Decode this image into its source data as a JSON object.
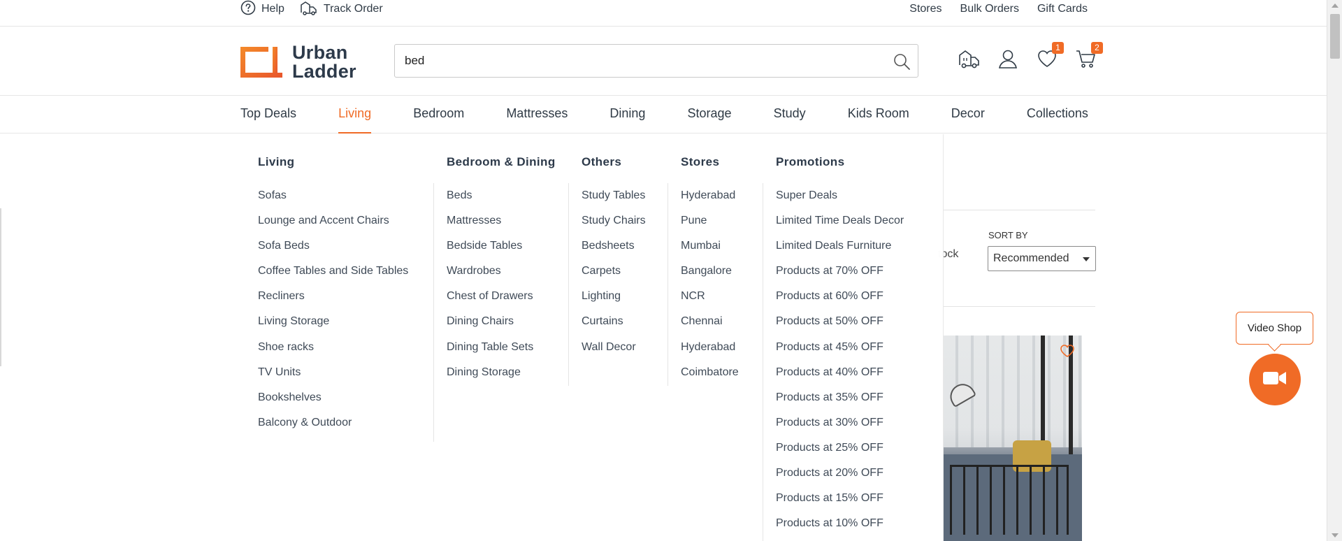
{
  "topbar": {
    "help_label": "Help",
    "track_order_label": "Track Order",
    "links": [
      "Stores",
      "Bulk Orders",
      "Gift Cards"
    ]
  },
  "header": {
    "logo_line1": "Urban",
    "logo_line2": "Ladder",
    "search_value": "bed",
    "wishlist_count": "1",
    "cart_count": "2"
  },
  "nav": {
    "categories": [
      "Top Deals",
      "Living",
      "Bedroom",
      "Mattresses",
      "Dining",
      "Storage",
      "Study",
      "Kids Room",
      "Decor",
      "Collections"
    ],
    "active": "Living"
  },
  "megamenu": {
    "columns": [
      {
        "title": "Living",
        "items": [
          "Sofas",
          "Lounge and Accent Chairs",
          "Sofa Beds",
          "Coffee Tables and Side Tables",
          "Recliners",
          "Living Storage",
          "Shoe racks",
          "TV Units",
          "Bookshelves",
          "Balcony & Outdoor"
        ]
      },
      {
        "title": "Bedroom & Dining",
        "items": [
          "Beds",
          "Mattresses",
          "Bedside Tables",
          "Wardrobes",
          "Chest of Drawers",
          "Dining Chairs",
          "Dining Table Sets",
          "Dining Storage"
        ]
      },
      {
        "title": "Others",
        "items": [
          "Study Tables",
          "Study Chairs",
          "Bedsheets",
          "Carpets",
          "Lighting",
          "Curtains",
          "Wall Decor"
        ]
      },
      {
        "title": "Stores",
        "items": [
          "Hyderabad",
          "Pune",
          "Mumbai",
          "Bangalore",
          "NCR",
          "Chennai",
          "Hyderabad",
          "Coimbatore"
        ]
      },
      {
        "title": "Promotions",
        "items": [
          "Super Deals",
          "Limited Time Deals Decor",
          "Limited Deals Furniture",
          "Products at 70% OFF",
          "Products at 60% OFF",
          "Products at 50% OFF",
          "Products at 45% OFF",
          "Products at 40% OFF",
          "Products at 35% OFF",
          "Products at 30% OFF",
          "Products at 25% OFF",
          "Products at 20% OFF",
          "Products at 15% OFF",
          "Products at 10% OFF"
        ]
      }
    ]
  },
  "listing": {
    "sort_label": "SORT BY",
    "sort_value": "Recommended",
    "stock_text_fragment": "tock"
  },
  "video_shop": {
    "label": "Video Shop"
  },
  "colors": {
    "accent": "#f06b26",
    "text": "#2f3a45"
  }
}
